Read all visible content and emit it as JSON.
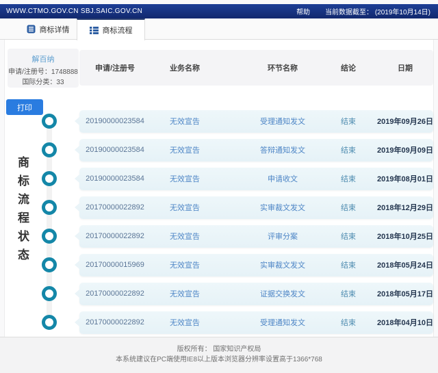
{
  "topbar": {
    "site": "WWW.CTMO.GOV.CN SBJ.SAIC.GOV.CN",
    "help_label": "帮助",
    "data_cutoff": "当前数据截至： (2019年10月14日)"
  },
  "tabs": {
    "details": {
      "label": "商标详情",
      "active": false
    },
    "process": {
      "label": "商标流程",
      "active": true
    }
  },
  "trademark_card": {
    "name": "解百纳",
    "registration": "申请/注册号：1748888",
    "intl_class": "国际分类：33"
  },
  "print_button_label": "打印",
  "sidebar_title": "商标流程状态",
  "table": {
    "columns": [
      "申请/注册号",
      "业务名称",
      "环节名称",
      "结论",
      "日期"
    ],
    "rows": [
      [
        "20190000023584",
        "无效宣告",
        "受理通知发文",
        "结束",
        "2019年09月26日"
      ],
      [
        "20190000023584",
        "无效宣告",
        "答辩通知发文",
        "结束",
        "2019年09月09日"
      ],
      [
        "20190000023584",
        "无效宣告",
        "申请收文",
        "结束",
        "2019年08月01日"
      ],
      [
        "20170000022892",
        "无效宣告",
        "实审裁文发文",
        "结束",
        "2018年12月29日"
      ],
      [
        "20170000022892",
        "无效宣告",
        "评审分案",
        "结束",
        "2018年10月25日"
      ],
      [
        "20170000015969",
        "无效宣告",
        "实审裁文发文",
        "结束",
        "2018年05月24日"
      ],
      [
        "20170000022892",
        "无效宣告",
        "证据交换发文",
        "结束",
        "2018年05月17日"
      ],
      [
        "20170000022892",
        "无效宣告",
        "受理通知发文",
        "结束",
        "2018年04月10日"
      ]
    ]
  },
  "footer": {
    "copyright": "版权所有： 国家知识产权局",
    "advice": "本系统建议在PC端使用IE8以上版本浏览器分辨率设置高于1366*768"
  },
  "colors": {
    "topbar_navy": "#16307c",
    "active_tab_border": "#2b3f70",
    "tab_icon_blue": "#2e5fa3",
    "print_button_blue": "#2a7ce0",
    "timeline_teal": "#1487a8",
    "row_background": "#e9f4f8",
    "link_blue": "#4e86c6",
    "date_navy": "#24364f"
  }
}
